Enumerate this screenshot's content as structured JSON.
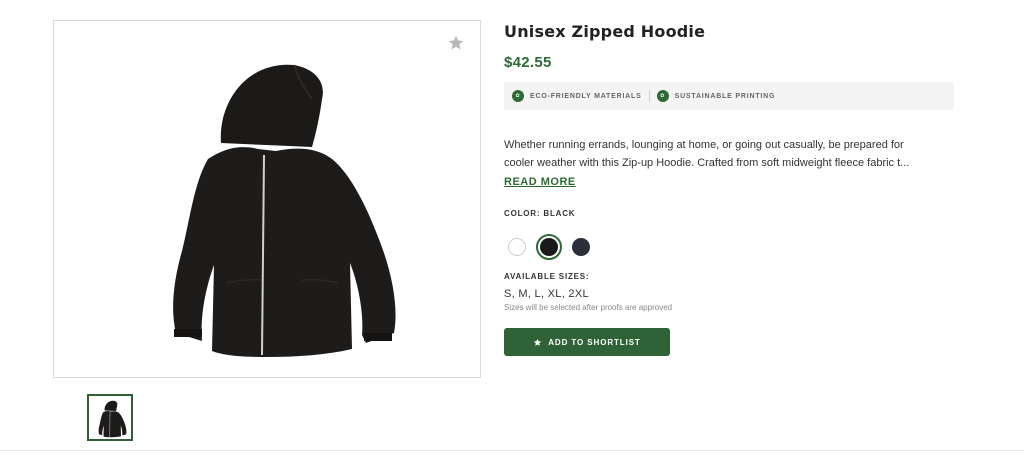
{
  "product": {
    "title": "Unisex Zipped Hoodie",
    "price": "$42.55",
    "badges": [
      {
        "icon": "eco-leaf-icon",
        "label": "ECO-FRIENDLY MATERIALS"
      },
      {
        "icon": "sustainable-leaf-icon",
        "label": "SUSTAINABLE PRINTING"
      }
    ],
    "description_line1": "Whether running errands, lounging at home, or going out casually, be prepared for",
    "description_line2": "cooler weather with this Zip-up Hoodie. Crafted from soft midweight fleece fabric t...",
    "read_more": "READ MORE",
    "color_label": "COLOR: BLACK",
    "colors": [
      {
        "name": "white",
        "hex": "#ffffff",
        "selected": false
      },
      {
        "name": "black",
        "hex": "#1a1a1a",
        "selected": true
      },
      {
        "name": "navy",
        "hex": "#2b2f3a",
        "selected": false
      }
    ],
    "sizes_label": "AVAILABLE SIZES:",
    "sizes": "S, M, L, XL, 2XL",
    "sizes_note": "Sizes will be selected after proofs are approved",
    "shortlist_button": "ADD TO SHORTLIST"
  },
  "theme": {
    "accent": "#2d6a34",
    "button": "#2f6337"
  }
}
